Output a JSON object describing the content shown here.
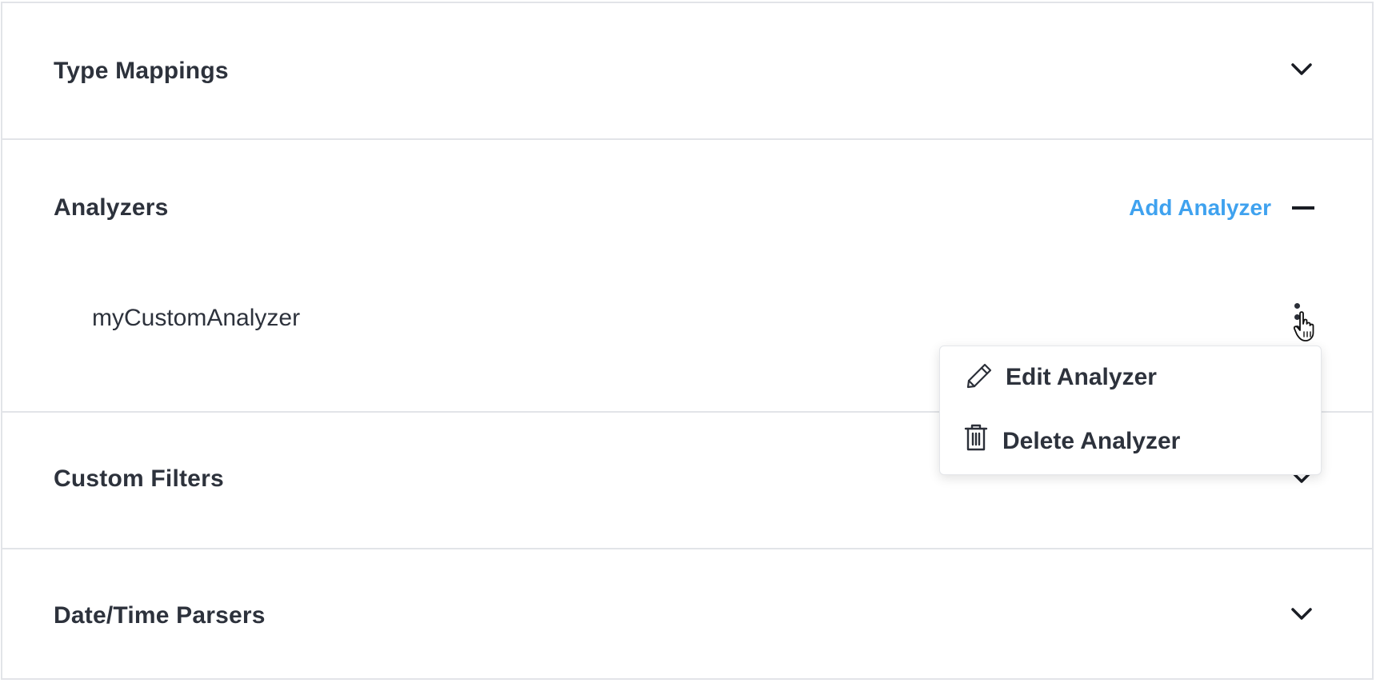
{
  "sections": [
    {
      "title": "Type Mappings",
      "state": "collapsed"
    },
    {
      "title": "Analyzers",
      "state": "expanded",
      "action_label": "Add Analyzer",
      "items": [
        {
          "name": "myCustomAnalyzer"
        }
      ]
    },
    {
      "title": "Custom Filters",
      "state": "collapsed"
    },
    {
      "title": "Date/Time Parsers",
      "state": "collapsed"
    }
  ],
  "context_menu": {
    "items": [
      {
        "label": "Edit Analyzer",
        "icon": "pencil-icon"
      },
      {
        "label": "Delete Analyzer",
        "icon": "trash-icon"
      }
    ]
  },
  "colors": {
    "accent": "#3fa2ef",
    "text": "#2d323c",
    "border": "#e2e4e8"
  }
}
